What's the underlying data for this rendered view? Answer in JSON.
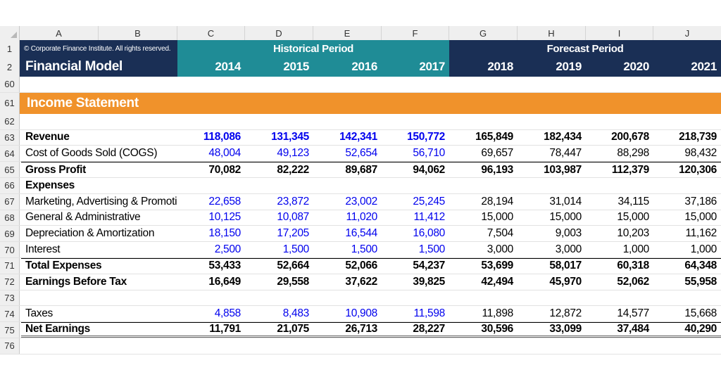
{
  "columns": [
    "A",
    "B",
    "C",
    "D",
    "E",
    "F",
    "G",
    "H",
    "I",
    "J"
  ],
  "header": {
    "copyright": "© Corporate Finance Institute. All rights reserved.",
    "historical_label": "Historical Period",
    "forecast_label": "Forecast Period",
    "model_title": "Financial Model",
    "years": [
      "2014",
      "2015",
      "2016",
      "2017",
      "2018",
      "2019",
      "2020",
      "2021"
    ]
  },
  "section_title": "Income Statement",
  "row_numbers": {
    "r1": "1",
    "r2": "2",
    "r60": "60",
    "r61": "61",
    "r62": "62",
    "r73": "73",
    "r76": "76"
  },
  "rows": [
    {
      "num": "63",
      "label": "Revenue",
      "values": [
        "118,086",
        "131,345",
        "142,341",
        "150,772",
        "165,849",
        "182,434",
        "200,678",
        "218,739"
      ]
    },
    {
      "num": "64",
      "label": "Cost of Goods Sold (COGS)",
      "values": [
        "48,004",
        "49,123",
        "52,654",
        "56,710",
        "69,657",
        "78,447",
        "88,298",
        "98,432"
      ]
    },
    {
      "num": "65",
      "label": "Gross Profit",
      "values": [
        "70,082",
        "82,222",
        "89,687",
        "94,062",
        "96,193",
        "103,987",
        "112,379",
        "120,306"
      ]
    },
    {
      "num": "66",
      "label": "Expenses",
      "values": [
        "",
        "",
        "",
        "",
        "",
        "",
        "",
        ""
      ]
    },
    {
      "num": "67",
      "label": "Marketing, Advertising & Promotior",
      "values": [
        "22,658",
        "23,872",
        "23,002",
        "25,245",
        "28,194",
        "31,014",
        "34,115",
        "37,186"
      ]
    },
    {
      "num": "68",
      "label": "General & Administrative",
      "values": [
        "10,125",
        "10,087",
        "11,020",
        "11,412",
        "15,000",
        "15,000",
        "15,000",
        "15,000"
      ]
    },
    {
      "num": "69",
      "label": "Depreciation & Amortization",
      "values": [
        "18,150",
        "17,205",
        "16,544",
        "16,080",
        "7,504",
        "9,003",
        "10,203",
        "11,162"
      ]
    },
    {
      "num": "70",
      "label": "Interest",
      "values": [
        "2,500",
        "1,500",
        "1,500",
        "1,500",
        "3,000",
        "3,000",
        "1,000",
        "1,000"
      ]
    },
    {
      "num": "71",
      "label": "Total Expenses",
      "values": [
        "53,433",
        "52,664",
        "52,066",
        "54,237",
        "53,699",
        "58,017",
        "60,318",
        "64,348"
      ]
    },
    {
      "num": "72",
      "label": "Earnings Before Tax",
      "values": [
        "16,649",
        "29,558",
        "37,622",
        "39,825",
        "42,494",
        "45,970",
        "52,062",
        "55,958"
      ]
    },
    {
      "num": "74",
      "label": "Taxes",
      "values": [
        "4,858",
        "8,483",
        "10,908",
        "11,598",
        "11,898",
        "12,872",
        "14,577",
        "15,668"
      ]
    },
    {
      "num": "75",
      "label": "Net Earnings",
      "values": [
        "11,791",
        "21,075",
        "26,713",
        "28,227",
        "30,596",
        "33,099",
        "37,484",
        "40,290"
      ]
    }
  ],
  "colors": {
    "navy": "#1a2f55",
    "teal": "#1f8c96",
    "orange": "#f0922b",
    "historical_input": "#0000ee"
  }
}
